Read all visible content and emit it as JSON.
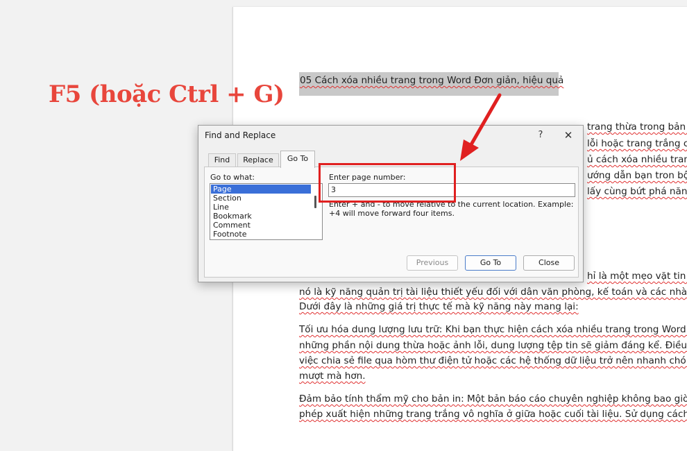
{
  "overlay": {
    "shortcut_label": "F5 (hoặc Ctrl + G)"
  },
  "document": {
    "title_line": "05 Cách xóa nhiều trang trong Word Đơn giản, hiệu quả",
    "right_fragments": [
      "trang thừa trong bản t",
      "lỗi hoặc trang trắng c",
      "ủ cách xóa nhiều trang",
      "ướng dẫn bạn tron bộ b",
      "lấy cùng bứt phá năng"
    ],
    "line_after_dialog": "hỉ là một mẹo vặt tin h",
    "paragraph1": [
      "nó là kỹ năng quản trị tài liệu thiết yếu đối với dân văn phòng, kế toán và các nhà qu",
      "Dưới đây là những giá trị thực tế mà kỹ năng này mang lại:"
    ],
    "paragraph2": [
      "Tối ưu hóa dung lượng lưu trữ: Khi bạn thực hiện cách xóa nhiều trang trong Word c",
      "những phần nội dung thừa hoặc ảnh lỗi, dung lượng tệp tin sẽ giảm đáng kể. Điều n",
      "việc chia sẻ file qua hòm thư điện tử hoặc các hệ thống dữ liệu trở nên nhanh chón",
      "mượt mà hơn."
    ],
    "paragraph3": [
      "Đảm bảo tính thẩm mỹ cho bản in: Một bản báo cáo chuyên nghiệp không bao giờ",
      "phép xuất hiện những trang trắng vô nghĩa ở giữa hoặc cuối tài liệu. Sử dụng cách x"
    ]
  },
  "dialog": {
    "title": "Find and Replace",
    "help_label": "?",
    "close_label": "✕",
    "tabs": [
      {
        "label": "Find",
        "active": false
      },
      {
        "label": "Replace",
        "active": false
      },
      {
        "label": "Go To",
        "active": true
      }
    ],
    "goto_what_label": "Go to what:",
    "goto_items": [
      "Page",
      "Section",
      "Line",
      "Bookmark",
      "Comment",
      "Footnote"
    ],
    "selected_item": "Page",
    "page_number_label": "Enter page number:",
    "page_number_value": "3",
    "hint_text": "Enter + and - to move relative to the current location. Example: +4 will move forward four items.",
    "buttons": {
      "previous": "Previous",
      "go_to": "Go To",
      "close": "Close"
    }
  },
  "colors": {
    "annotation_red": "#e02020",
    "overlay_text": "#e8463c",
    "selection_blue": "#3a6fd8"
  }
}
